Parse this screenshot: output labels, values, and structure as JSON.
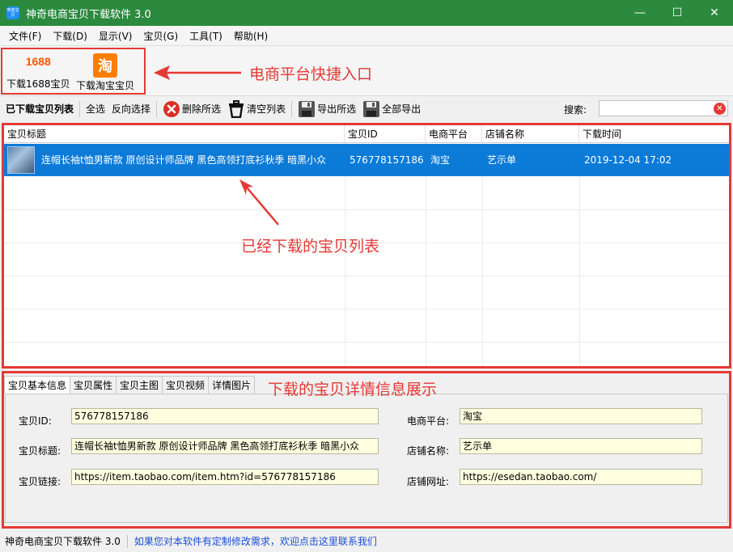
{
  "window": {
    "title": "神奇电商宝贝下载软件 3.0",
    "icon_text": "电商宝贝",
    "controls": {
      "minimize": "—",
      "maximize": "☐",
      "close": "✕"
    }
  },
  "menu": [
    {
      "label": "文件(F)"
    },
    {
      "label": "下载(D)"
    },
    {
      "label": "显示(V)"
    },
    {
      "label": "宝贝(G)"
    },
    {
      "label": "工具(T)"
    },
    {
      "label": "帮助(H)"
    }
  ],
  "quickbar": {
    "btn_1688": {
      "logo": "1688",
      "label": "下载1688宝贝"
    },
    "btn_taobao": {
      "logo": "淘",
      "label": "下载淘宝宝贝"
    }
  },
  "annotations": {
    "quick_entry": "电商平台快捷入口",
    "list": "已经下载的宝贝列表",
    "detail": "下载的宝贝详情信息展示",
    "color": "#e53935"
  },
  "toolbar": {
    "list_title": "已下载宝贝列表",
    "select_all": "全选",
    "invert_select": "反向选择",
    "delete_selected": "删除所选",
    "clear_list": "清空列表",
    "export_selected": "导出所选",
    "export_all": "全部导出",
    "search_label": "搜索:",
    "search_value": ""
  },
  "table": {
    "columns": [
      "宝贝标题",
      "宝贝ID",
      "电商平台",
      "店铺名称",
      "下载时间"
    ],
    "rows": [
      {
        "title": "连帽长袖t恤男新款 原创设计师品牌 黑色高领打底衫秋季 暗黑小众",
        "id": "576778157186",
        "platform": "淘宝",
        "shop": "艺示单",
        "time": "2019-12-04 17:02"
      }
    ],
    "selected_color": "#0c7bd8"
  },
  "detail": {
    "tabs": [
      "宝贝基本信息",
      "宝贝属性",
      "宝贝主图",
      "宝贝视频",
      "详情图片"
    ],
    "fields": {
      "item_id": {
        "label": "宝贝ID:",
        "value": "576778157186"
      },
      "item_title": {
        "label": "宝贝标题:",
        "value": "连帽长袖t恤男新款 原创设计师品牌 黑色高领打底衫秋季 暗黑小众"
      },
      "item_link": {
        "label": "宝贝链接:",
        "value": "https://item.taobao.com/item.htm?id=576778157186"
      },
      "platform": {
        "label": "电商平台:",
        "value": "淘宝"
      },
      "shop_name": {
        "label": "店铺名称:",
        "value": "艺示单"
      },
      "shop_url": {
        "label": "店铺网址:",
        "value": "https://esedan.taobao.com/"
      }
    }
  },
  "statusbar": {
    "app": "神奇电商宝贝下载软件 3.0",
    "link": "如果您对本软件有定制修改需求，欢迎点击这里联系我们"
  }
}
